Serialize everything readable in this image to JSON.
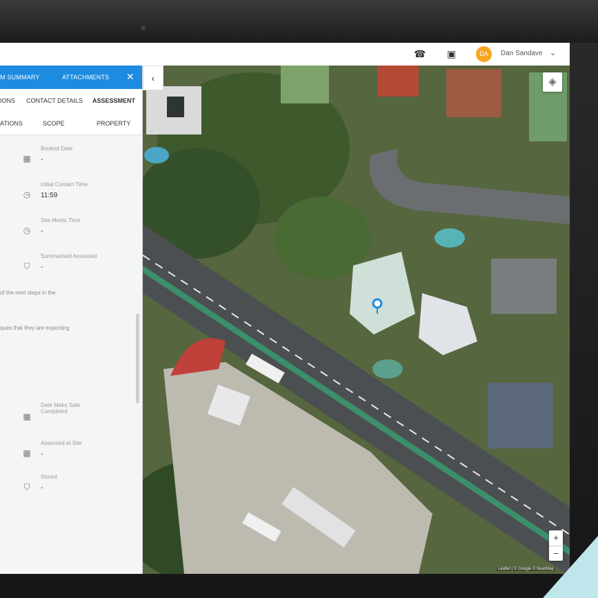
{
  "header": {
    "user_initials": "DA",
    "user_name": "Dan Sandave"
  },
  "panel": {
    "top_tabs": [
      "M SUMMARY",
      "ATTACHMENTS"
    ],
    "second_tabs": [
      "IONS",
      "CONTACT DETAILS",
      "ASSESSMENT"
    ],
    "third_tabs": [
      "ATIONS",
      "SCOPE",
      "PROPERTY"
    ],
    "fields": [
      {
        "label": "Booked Date",
        "value": "-",
        "icon": "calendar-icon"
      },
      {
        "label": "Initial Contact Time",
        "value": "11:59",
        "icon": "clock-icon"
      },
      {
        "label": "Site Meets Time",
        "value": "-",
        "icon": "clock-icon"
      },
      {
        "label": "Summarised Assessed",
        "value": "-",
        "icon": "shield-icon"
      },
      {
        "label": "Date Make Safe Completed",
        "value": "",
        "icon": "calendar-icon"
      },
      {
        "label": "Assessed at Site",
        "value": "-",
        "icon": "calendar-icon"
      },
      {
        "label": "Stored",
        "value": "-",
        "icon": "shield-icon"
      }
    ],
    "stray_texts": [
      "of the next steps in the",
      "ques that they are expecting"
    ]
  },
  "map": {
    "attribution": "Leaflet | © Google  © NearMap",
    "zoom_in": "+",
    "zoom_out": "−"
  }
}
